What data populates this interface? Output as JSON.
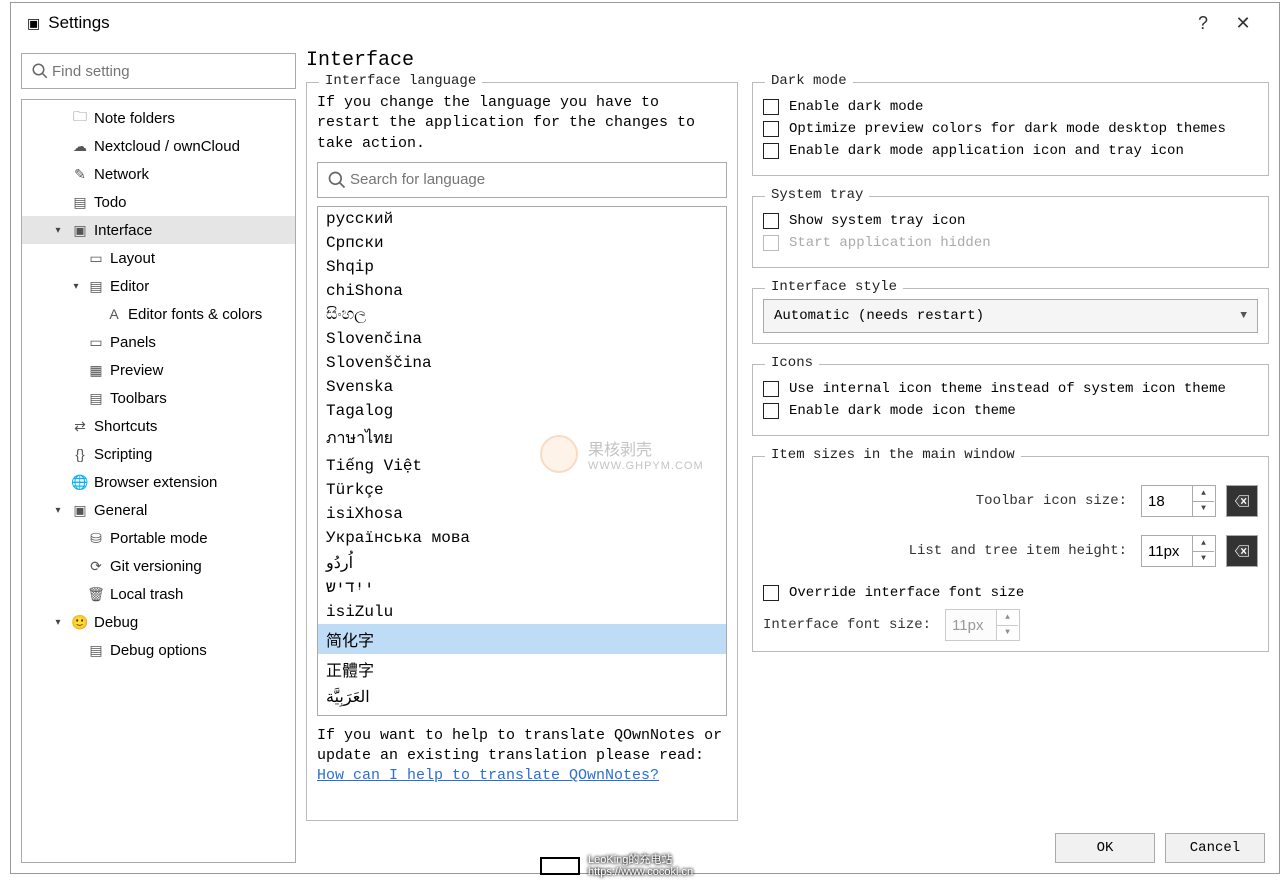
{
  "window": {
    "title": "Settings",
    "help": "?",
    "close": "✕"
  },
  "search_placeholder": "Find setting",
  "sidebar": [
    {
      "label": "Note folders",
      "icon": "folder-icon",
      "glyph": "🗀",
      "indent": 48
    },
    {
      "label": "Nextcloud / ownCloud",
      "icon": "cloud-icon",
      "glyph": "☁",
      "indent": 48
    },
    {
      "label": "Network",
      "icon": "network-icon",
      "glyph": "✎",
      "indent": 48
    },
    {
      "label": "Todo",
      "icon": "todo-icon",
      "glyph": "▤",
      "indent": 48
    },
    {
      "label": "Interface",
      "icon": "interface-icon",
      "glyph": "▣",
      "indent": 48,
      "arrow": "▾",
      "arrow_indent": 28,
      "selected": true
    },
    {
      "label": "Layout",
      "icon": "layout-icon",
      "glyph": "▭",
      "indent": 64
    },
    {
      "label": "Editor",
      "icon": "editor-icon",
      "glyph": "▤",
      "indent": 64,
      "arrow": "▾",
      "arrow_indent": 46
    },
    {
      "label": "Editor fonts & colors",
      "icon": "fonts-icon",
      "glyph": "A",
      "indent": 82
    },
    {
      "label": "Panels",
      "icon": "panels-icon",
      "glyph": "▭",
      "indent": 64
    },
    {
      "label": "Preview",
      "icon": "preview-icon",
      "glyph": "▦",
      "indent": 64
    },
    {
      "label": "Toolbars",
      "icon": "toolbars-icon",
      "glyph": "▤",
      "indent": 64
    },
    {
      "label": "Shortcuts",
      "icon": "shortcuts-icon",
      "glyph": "⇄",
      "indent": 48
    },
    {
      "label": "Scripting",
      "icon": "scripting-icon",
      "glyph": "{}",
      "indent": 48
    },
    {
      "label": "Browser extension",
      "icon": "browser-icon",
      "glyph": "🌐",
      "indent": 48
    },
    {
      "label": "General",
      "icon": "general-icon",
      "glyph": "▣",
      "indent": 48,
      "arrow": "▾",
      "arrow_indent": 28
    },
    {
      "label": "Portable mode",
      "icon": "portable-icon",
      "glyph": "⛁",
      "indent": 64
    },
    {
      "label": "Git versioning",
      "icon": "git-icon",
      "glyph": "⟳",
      "indent": 64
    },
    {
      "label": "Local trash",
      "icon": "trash-icon",
      "glyph": "🗑",
      "indent": 64
    },
    {
      "label": "Debug",
      "icon": "debug-icon",
      "glyph": "🙂",
      "indent": 48,
      "arrow": "▾",
      "arrow_indent": 28,
      "smile": true
    },
    {
      "label": "Debug options",
      "icon": "debug-opts-icon",
      "glyph": "▤",
      "indent": 64
    }
  ],
  "page": {
    "title": "Interface",
    "lang_group_title": "Interface language",
    "lang_note": "If you change the language you have to restart the application for the changes to take action.",
    "lang_search_placeholder": "Search for language",
    "lang_help_prefix": "If you want to help to translate QOwnNotes or update an existing translation please read: ",
    "lang_help_link": "How can I help to translate QOwnNotes?",
    "languages": [
      "русский",
      "Српски",
      "Shqip",
      "chiShona",
      "සිංහල",
      "Slovenčina",
      "Slovenščina",
      "Svenska",
      "Tagalog",
      "ภาษาไทย",
      "Tiếng Việt",
      "Türkçe",
      "isiXhosa",
      "Українська мова",
      "اُردُو",
      "ייִדיש",
      "isiZulu",
      "简化字",
      "正體字",
      "العَرَبِيَّة"
    ],
    "lang_selected_index": 17
  },
  "dark": {
    "title": "Dark mode",
    "enable": "Enable dark mode",
    "optimize": "Optimize preview colors for dark mode desktop themes",
    "icon": "Enable dark mode application icon and tray icon"
  },
  "tray": {
    "title": "System tray",
    "show": "Show system tray icon",
    "hidden": "Start application hidden"
  },
  "style": {
    "title": "Interface style",
    "value": "Automatic (needs restart)"
  },
  "icons": {
    "title": "Icons",
    "internal": "Use internal icon theme instead of system icon theme",
    "dark": "Enable dark mode icon theme"
  },
  "sizes": {
    "title": "Item sizes in the main window",
    "toolbar_label": "Toolbar icon size:",
    "toolbar_value": "18",
    "list_label": "List and tree item height:",
    "list_value": "11px",
    "override": "Override interface font size",
    "font_label": "Interface font size:",
    "font_value": "11px"
  },
  "buttons": {
    "ok": "OK",
    "cancel": "Cancel"
  },
  "watermark": {
    "main": "果核剥壳",
    "sub": "WWW.GHPYM.COM"
  },
  "bottom_wm": {
    "line1": "LeoKing的充电站",
    "line2": "https://www.cocokl.cn"
  }
}
